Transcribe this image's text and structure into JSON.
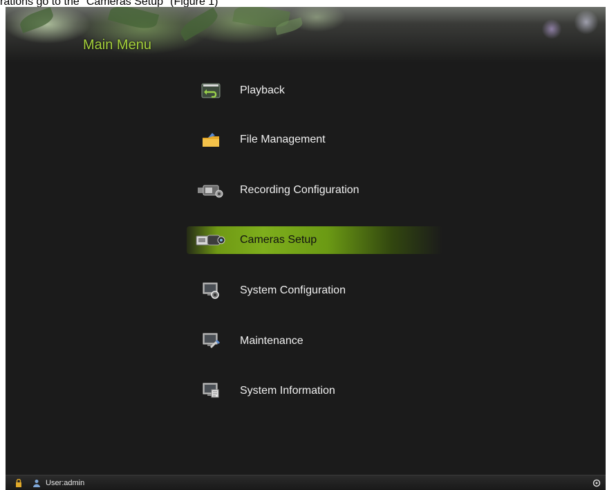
{
  "caption": "rations go to the \"Cameras Setup\" (Figure 1)",
  "header": {
    "title": "Main Menu"
  },
  "menu": {
    "items": [
      {
        "label": "Playback",
        "icon": "playback-icon",
        "selected": false
      },
      {
        "label": "File Management",
        "icon": "folder-icon",
        "selected": false
      },
      {
        "label": "Recording Configuration",
        "icon": "camera-recording-icon",
        "selected": false
      },
      {
        "label": "Cameras Setup",
        "icon": "camera-icon",
        "selected": true
      },
      {
        "label": "System Configuration",
        "icon": "monitor-gear-icon",
        "selected": false
      },
      {
        "label": "Maintenance",
        "icon": "monitor-wrench-icon",
        "selected": false
      },
      {
        "label": "System Information",
        "icon": "monitor-info-icon",
        "selected": false
      }
    ]
  },
  "statusbar": {
    "user_label": "User:admin",
    "icons": [
      "lock-icon",
      "user-icon",
      "power-icon"
    ]
  },
  "colors": {
    "accent": "#a6d23c",
    "selected_bar": "#7eae1c",
    "background": "#1b1b1b"
  }
}
